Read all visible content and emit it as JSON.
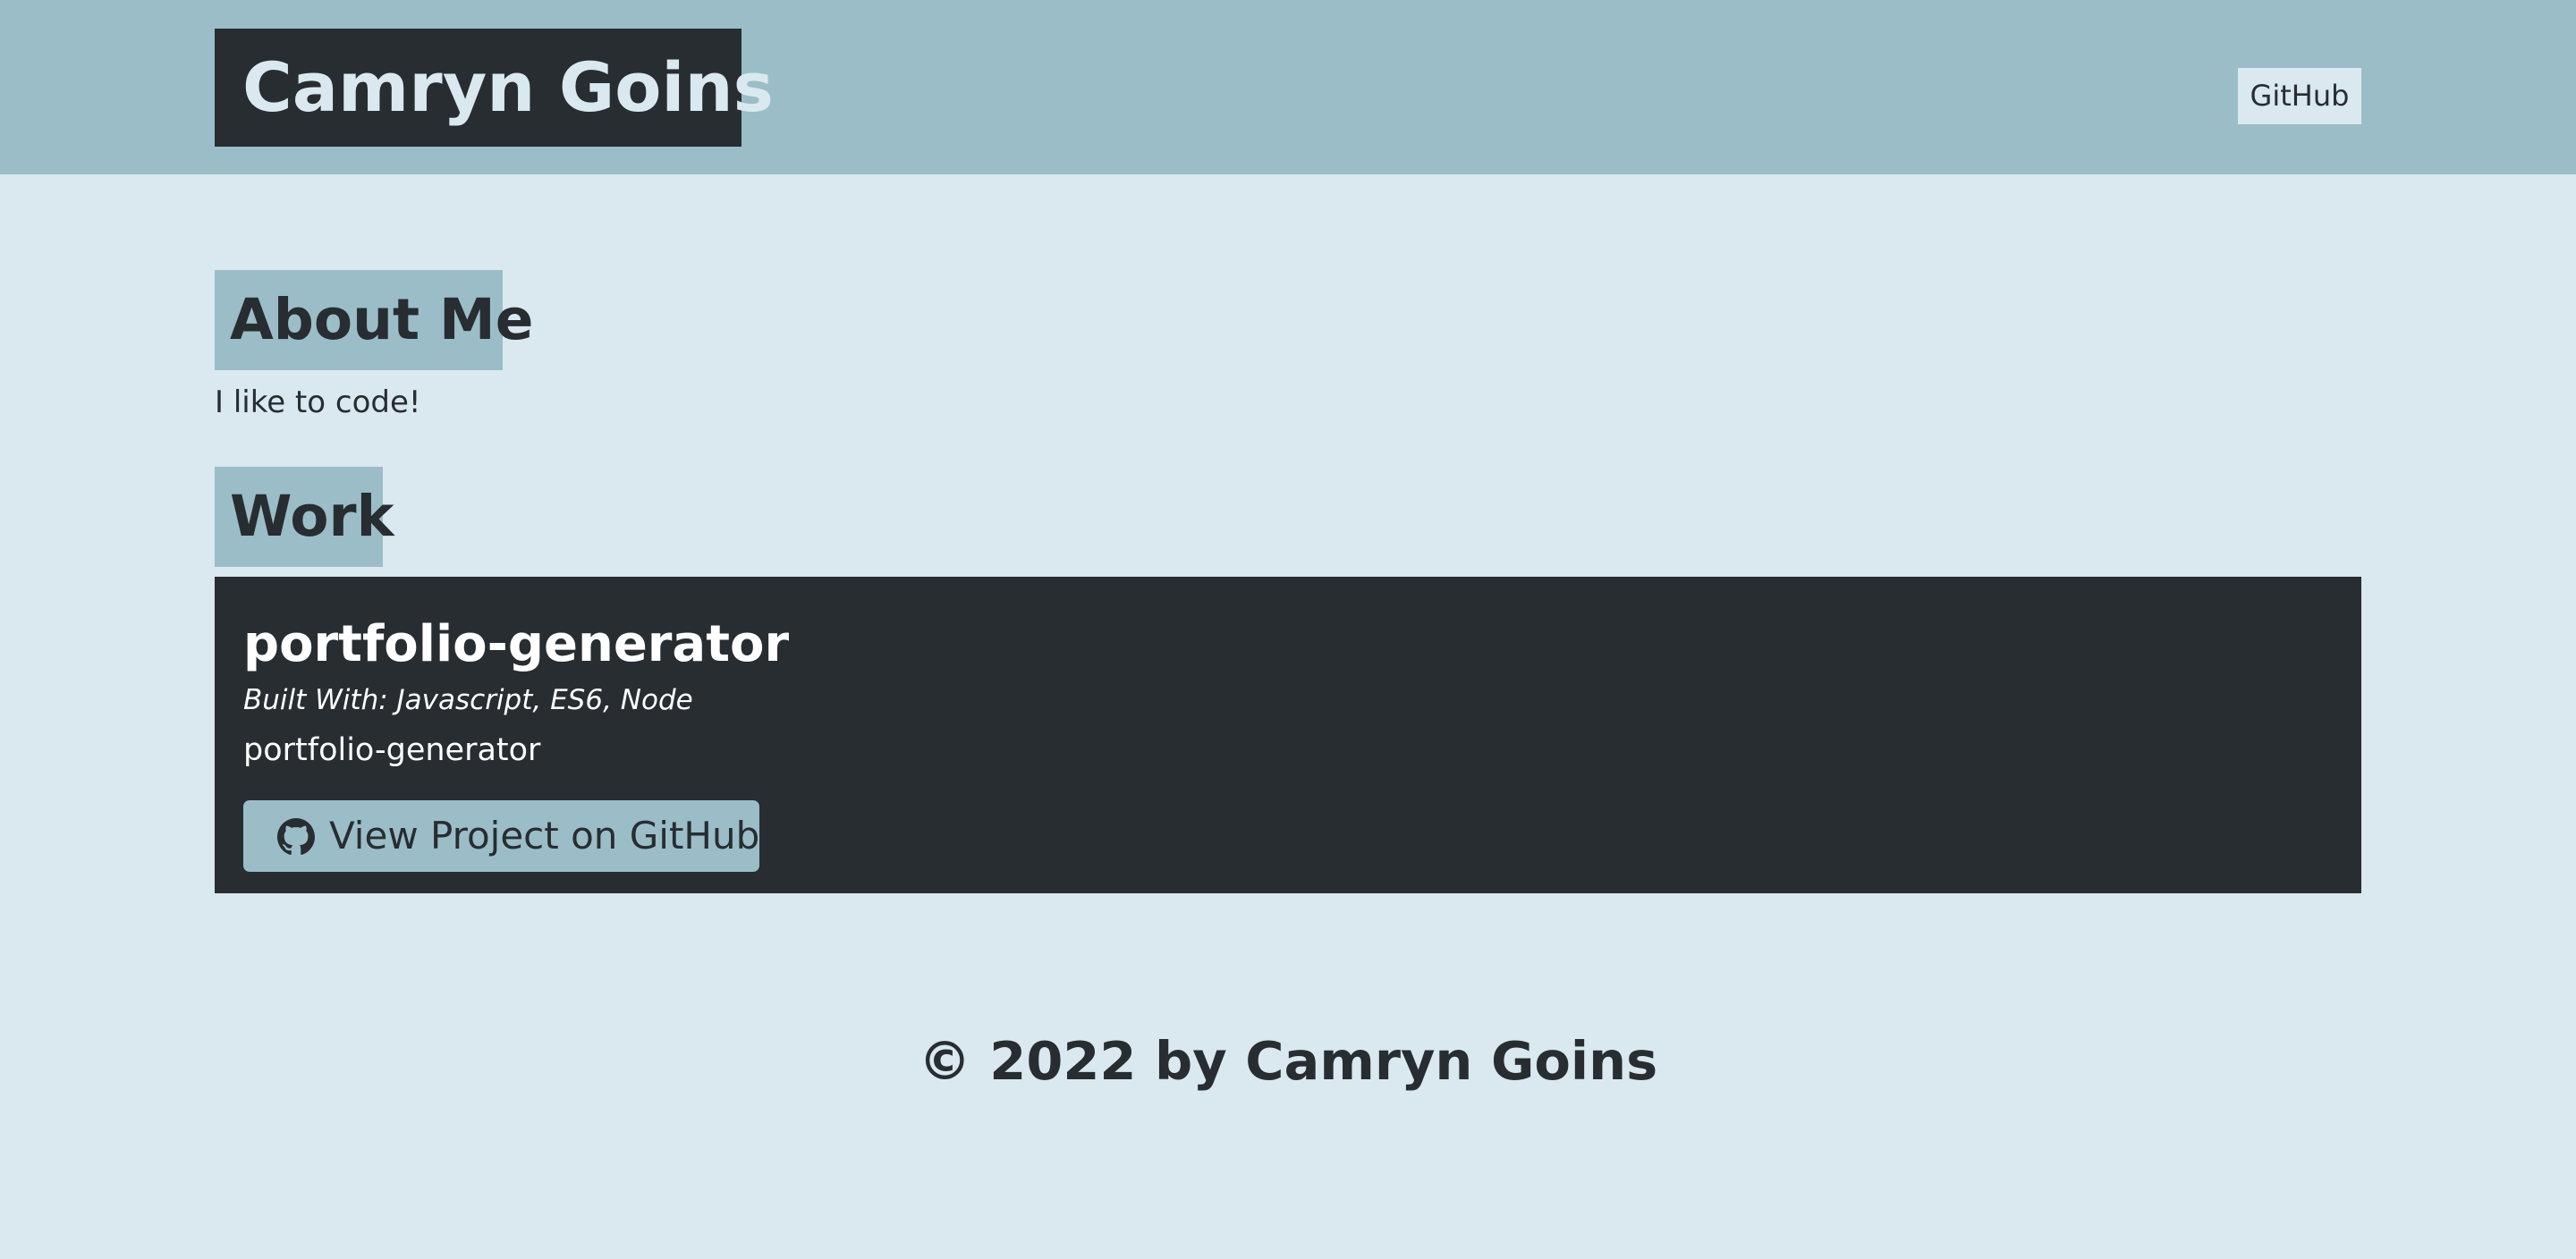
{
  "header": {
    "title": "Camryn Goins",
    "nav_link": "GitHub"
  },
  "about": {
    "heading": "About Me",
    "text": "I like to code!"
  },
  "work": {
    "heading": "Work",
    "project": {
      "name": "portfolio-generator",
      "languages": "Built With: Javascript, ES6, Node",
      "description": "portfolio-generator",
      "button_label": "View Project on GitHub",
      "button_icon": "github-icon"
    }
  },
  "footer": {
    "text": "© 2022 by Camryn Goins"
  },
  "colors": {
    "background": "#dae8ef",
    "accent": "#9bbdc7",
    "dark": "#272d31"
  }
}
